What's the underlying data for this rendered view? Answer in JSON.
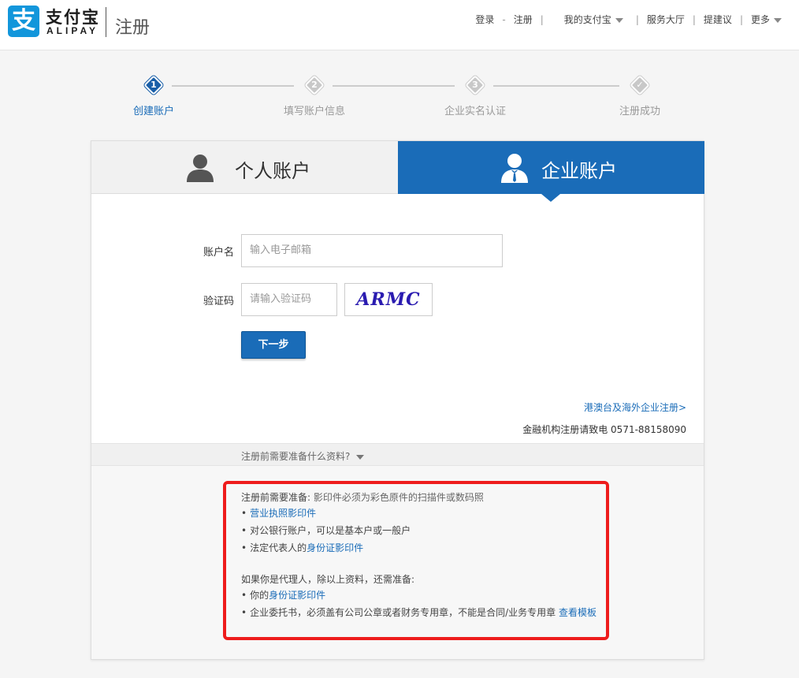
{
  "header": {
    "logo_glyph": "支",
    "brand_cn": "支付宝",
    "brand_en": "ALIPAY",
    "page_name": "注册",
    "nav": {
      "login": "登录",
      "dash": "-",
      "register": "注册",
      "my_alipay": "我的支付宝",
      "service_hall": "服务大厅",
      "feedback": "提建议",
      "more": "更多",
      "separator": "|"
    }
  },
  "steps": [
    {
      "num": "1",
      "label": "创建账户",
      "active": true
    },
    {
      "num": "2",
      "label": "填写账户信息",
      "active": false
    },
    {
      "num": "3",
      "label": "企业实名认证",
      "active": false
    },
    {
      "num": "✓",
      "label": "注册成功",
      "active": false
    }
  ],
  "tabs": {
    "personal": "个人账户",
    "enterprise": "企业账户",
    "selected": "enterprise"
  },
  "form": {
    "account_label": "账户名",
    "account_placeholder": "输入电子邮箱",
    "captcha_label": "验证码",
    "captcha_placeholder": "请输入验证码",
    "captcha_text": "ARMC",
    "next_button": "下一步"
  },
  "links": {
    "overseas": "港澳台及海外企业注册>",
    "hotline": "金融机构注册请致电 0571-88158090"
  },
  "prep": {
    "toggle": "注册前需要准备什么资料?",
    "heading": "注册前需要准备:",
    "heading_note": "影印件必须为彩色原件的扫描件或数码照",
    "item1_link": "营业执照影印件",
    "item2": "对公银行账户，可以是基本户或一般户",
    "item3_prefix": "法定代表人的",
    "item3_link": "身份证影印件",
    "agent_heading": "如果你是代理人，除以上资料，还需准备:",
    "agent1_prefix": "你的",
    "agent1_link": "身份证影印件",
    "agent2": "企业委托书，必须盖有公司公章或者财务专用章，不能是合同/业务专用章",
    "agent2_link": "查看模板",
    "bullet": "•"
  },
  "colors": {
    "brand_blue": "#1a6cb8",
    "highlight_red": "#ee1c1c"
  }
}
